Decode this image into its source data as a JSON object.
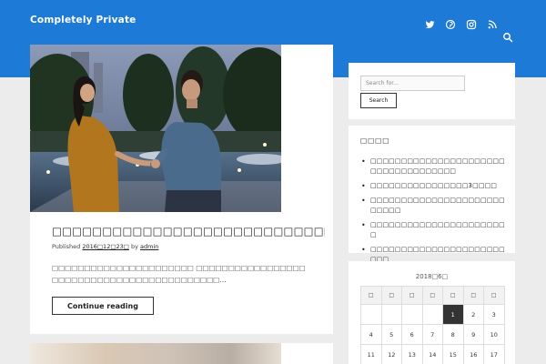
{
  "site": {
    "title": "Completely Private"
  },
  "header": {
    "social_icons": [
      "twitter-icon",
      "pinterest-icon",
      "instagram-icon",
      "rss-icon"
    ],
    "search_icon": "search-icon"
  },
  "post": {
    "title": "□□□□□□□□□□□□□□□□□□□□□□□□□□□□□□□□□□",
    "published_label": "Published ",
    "date": "2016□12□23□",
    "by_label": " by ",
    "author": "admin",
    "excerpt": "□□□□□□□□□□□□□□□□□□□□□□ □□□□□□□□□□□□□□□□□□□□□□□□□□□□□□□□□□□□□□□□□□□…",
    "continue_label": "Continue reading"
  },
  "sidebar": {
    "search": {
      "placeholder": "Search for...",
      "button_label": "Search"
    },
    "recent": {
      "heading": "□□□□",
      "items": [
        "□□□□□□□□□□□□□□□□□□□□□□□□□□□□□□□□□□□□",
        "□□□□□□□□□□□□□□□□3□□□□",
        "□□□□□□□□□□□□□□□□□□□□□□□□□□□",
        "□□□□□□□□□□□□□□□□□□□□□□□",
        "□□□□□□□□□□□□□□□□□□□□□□□□□"
      ]
    },
    "calendar": {
      "caption": "2018□6□",
      "weekdays": [
        "□",
        "□",
        "□",
        "□",
        "□",
        "□",
        "□"
      ],
      "rows": [
        [
          "",
          "",
          "",
          "",
          "1",
          "2",
          "3"
        ],
        [
          "4",
          "5",
          "6",
          "7",
          "8",
          "9",
          "10"
        ],
        [
          "11",
          "12",
          "13",
          "14",
          "15",
          "16",
          "17"
        ]
      ],
      "today": "1"
    }
  },
  "colors": {
    "header_blue": "#1d7ad6",
    "page_bg": "#ececec",
    "today_bg": "#333333"
  }
}
